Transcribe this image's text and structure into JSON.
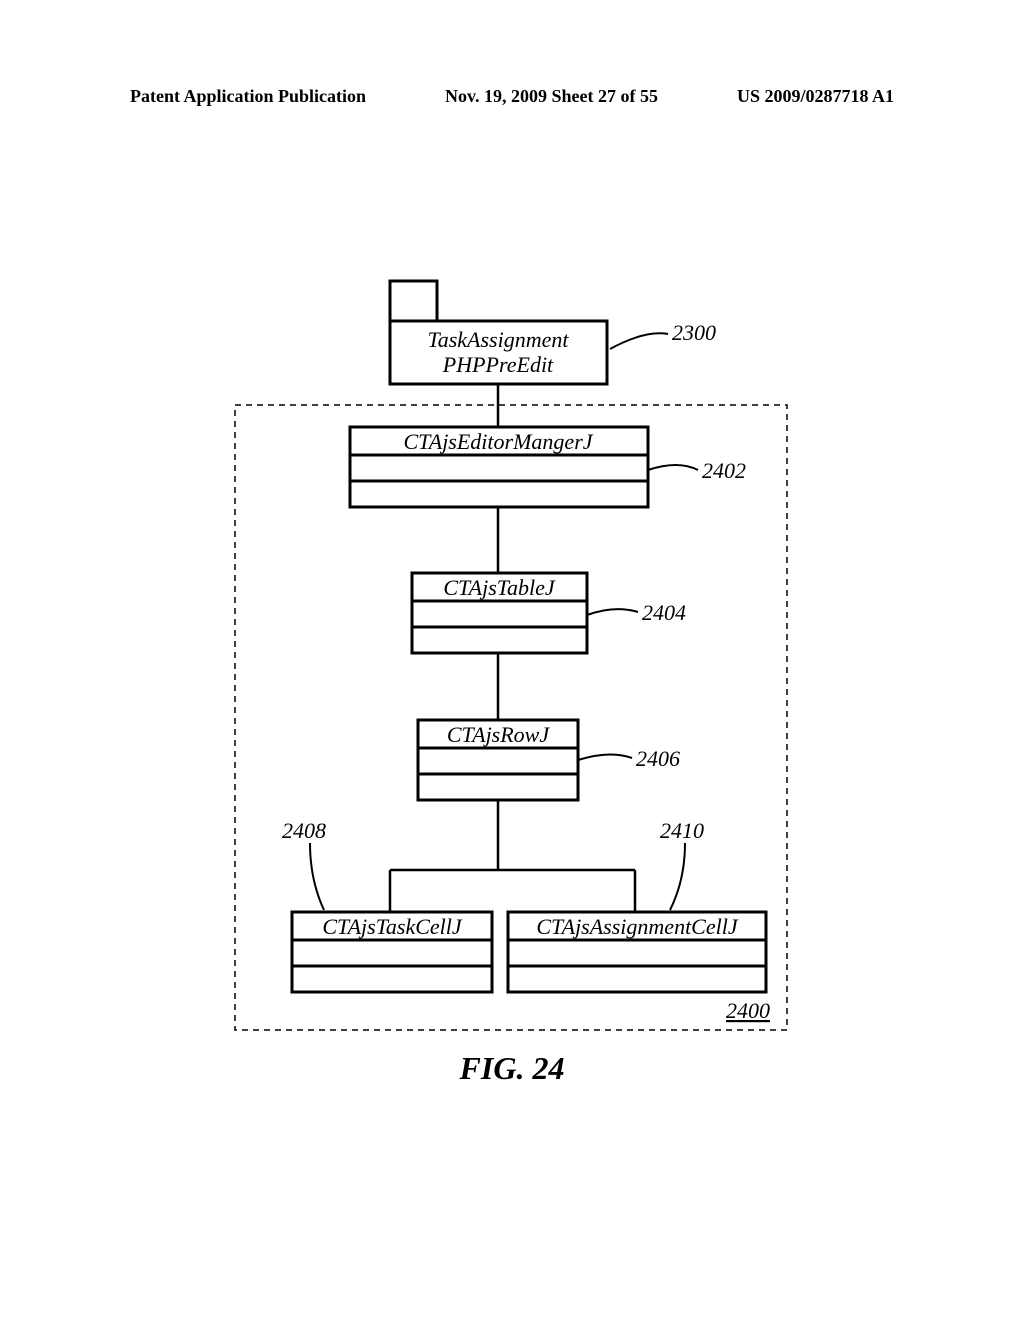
{
  "header": {
    "left": "Patent Application Publication",
    "center": "Nov. 19, 2009  Sheet 27 of 55",
    "right": "US 2009/0287718 A1"
  },
  "boxes": {
    "top_line1": "TaskAssignment",
    "top_line2": "PHPPreEdit",
    "b2402": "CTAjsEditorMangerJ",
    "b2404": "CTAjsTableJ",
    "b2406": "CTAjsRowJ",
    "b2408": "CTAjsTaskCellJ",
    "b2410": "CTAjsAssignmentCellJ"
  },
  "refs": {
    "r2300": "2300",
    "r2402": "2402",
    "r2404": "2404",
    "r2406": "2406",
    "r2408": "2408",
    "r2410": "2410",
    "r2400": "2400"
  },
  "caption": "FIG. 24"
}
